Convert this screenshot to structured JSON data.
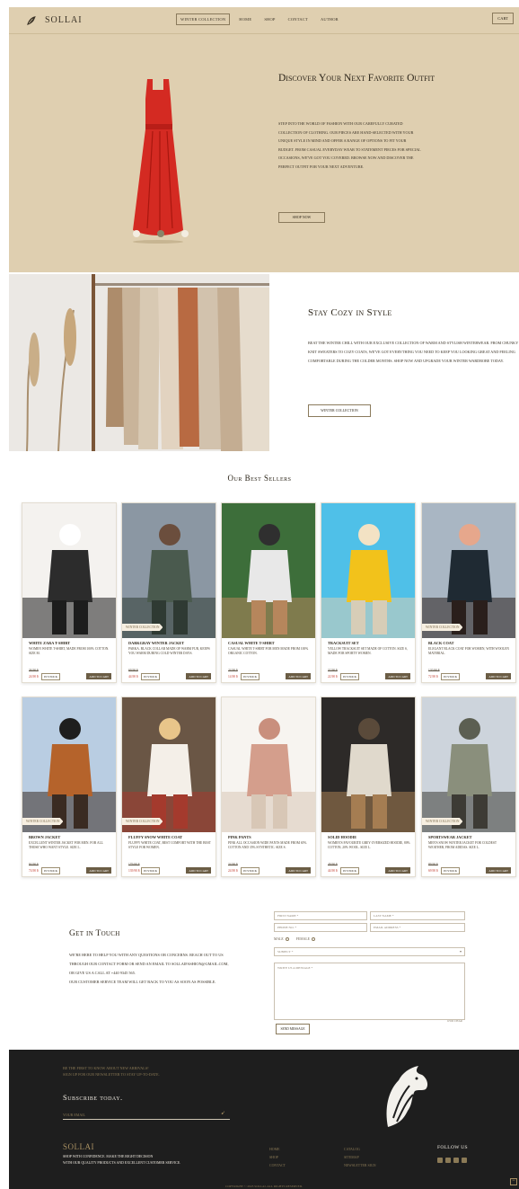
{
  "header": {
    "brand": "SOLLAI",
    "nav": [
      "WINTER COLLECTION",
      "HOME",
      "SHOP",
      "CONTACT",
      "AUTHOR"
    ],
    "cart": "CART"
  },
  "hero": {
    "title": "Discover Your Next Favorite Outfit",
    "text": "Step into the world of fashion with our carefully curated collection of clothing. Our pieces are hand-selected with your unique style in mind and offer a range of options to fit your budget. From casual everyday wear to statement pieces for special occasions, we've got you covered. Browse now and discover the perfect outfit for your next adventure.",
    "button": "SHOP NOW"
  },
  "cozy": {
    "title": "Stay Cozy in Style",
    "text": "Beat the winter chill with our exclusive collection of warm and stylish winterwear. From chunky knit sweaters to cozy coats, we've got everything you need to keep you looking great and feeling comfortable during the colder months. Shop now and upgrade your winter wardrobe today.",
    "button": "WINTER COLLECTION"
  },
  "bestsellers": {
    "title": "Our Best Sellers",
    "products": [
      {
        "name": "White Zara T-shirt",
        "desc": "Women white T-shirt, made from 100% cotton. Size M.",
        "old": "36.90 $",
        "new": "24.90 $",
        "stock": "IN STOCK",
        "add": "ADD TO CART",
        "badge": ""
      },
      {
        "name": "Darkgray Winter Jacket",
        "desc": "Parka. Black collar made of warm fur, keeps you warm during cold winter days.",
        "old": "69.90 $",
        "new": "44.90 $",
        "stock": "IN STOCK",
        "add": "ADD TO CART",
        "badge": "WINTER COLLECTION"
      },
      {
        "name": "Casual White T-shirt",
        "desc": "Casual white T-shirt for men made from 100% organic cotton.",
        "old": "24.90 $",
        "new": "14.90 $",
        "stock": "IN STOCK",
        "add": "ADD TO CART",
        "badge": ""
      },
      {
        "name": "Tracksuit set",
        "desc": "Yellow tracksuit set made of cotton. Size S, made for sporty women.",
        "old": "32.90 $",
        "new": "22.90 $",
        "stock": "IN STOCK",
        "add": "ADD TO CART",
        "badge": ""
      },
      {
        "name": "Black Coat",
        "desc": "Elegant black coat for women, with woolen material.",
        "old": "120.90 $",
        "new": "72.90 $",
        "stock": "IN STOCK",
        "add": "ADD TO CART",
        "badge": "WINTER COLLECTION"
      },
      {
        "name": "Brown Jacket",
        "desc": "Excellent winter jacket for men. For all those who want style. Size L.",
        "old": "94.90 $",
        "new": "74.90 $",
        "stock": "IN STOCK",
        "add": "ADD TO CART",
        "badge": "WINTER COLLECTION"
      },
      {
        "name": "Fluffy Snow White Coat",
        "desc": "Fluffy white coat, best comfort with the best style for women.",
        "old": "179.90 $",
        "new": "139.90 $",
        "stock": "IN STOCK",
        "add": "ADD TO CART",
        "badge": "WINTER COLLECTION"
      },
      {
        "name": "Pink Pants",
        "desc": "Pink all occasion wide pants made from 65% cotton and 35% synthetic. Size S.",
        "old": "34.90 $",
        "new": "24.90 $",
        "stock": "IN STOCK",
        "add": "ADD TO CART",
        "badge": ""
      },
      {
        "name": "Solid Hoodie",
        "desc": "Women's favourite grey oversized hoodie, 80% cotton, 20% wool. Size L.",
        "old": "49.90 $",
        "new": "44.90 $",
        "stock": "IN STOCK",
        "add": "ADD TO CART",
        "badge": ""
      },
      {
        "name": "Sportswear Jacket",
        "desc": "Men's snow winter jacket for coldest weather, from adidas. Size L.",
        "old": "89.90 $",
        "new": "69.90 $",
        "stock": "IN STOCK",
        "add": "ADD TO CART",
        "badge": "WINTER COLLECTION"
      }
    ]
  },
  "contact": {
    "title": "Get in Touch",
    "text1": "We're here to help you with any questions or concerns. Reach out to us through our contact form or send an email to sollaifashion@gmail.com, or give us a call at +440 9345 565.",
    "text2": "Our customer service team will get back to you as soon as possible.",
    "first_name": "FIRST NAME *",
    "last_name": "LAST NAME *",
    "phone": "PHONE NO. *",
    "email": "EMAIL ADDRESS *",
    "male": "MALE",
    "female": "FEMALE",
    "subject": "SUBJECT *",
    "message": "WRITE US A MESSAGE *",
    "counter": "0/500 CHAR",
    "send": "SEND MESSAGE"
  },
  "footer": {
    "top_line1": "BE THE FIRST TO KNOW ABOUT NEW ARRIVALS!",
    "top_line2": "SIGN UP FOR OUR NEWSLETTER TO STAY UP-TO-DATE.",
    "subscribe": "Subscribe today.",
    "email_placeholder": "YOUR EMAIL",
    "brand": "SOLLAI",
    "tag1": "Shop with confidence. Make the right decision",
    "tag2": "with our quality products and excellent customer service.",
    "col1": [
      "HOME",
      "SHOP",
      "CONTACT"
    ],
    "col2": [
      "CATALOG",
      "SITEMAP",
      "NEWSLETTER SIGN"
    ],
    "follow": "FOLLOW US",
    "copyright": "COPYRIGHT © 2023 SOLLAI. ALL RIGHTS RESERVED."
  }
}
